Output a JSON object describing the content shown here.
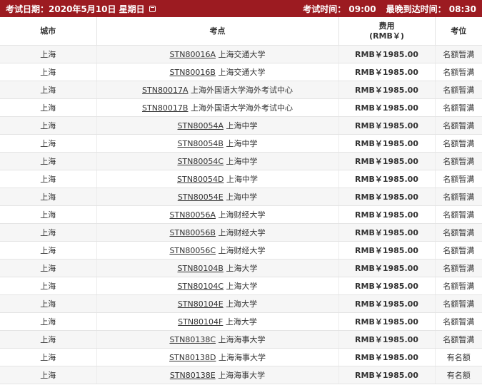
{
  "header": {
    "exam_date_label": "考试日期：",
    "exam_date_value": "2020年5月10日 星期日",
    "exam_time_label": "考试时间：",
    "exam_time_value": "09:00",
    "latest_arrival_label": "最晚到达时间：",
    "latest_arrival_value": "08:30",
    "icons": {
      "date": "calendar-icon"
    },
    "colors": {
      "bar": "#9c1b21"
    }
  },
  "table": {
    "columns": [
      "城市",
      "考点",
      "费用",
      "考位"
    ],
    "fee_unit": "(RMB￥)",
    "rows": [
      {
        "city": "上海",
        "code": "STN80016A",
        "venue": "上海交通大学",
        "fee": "RMB￥1985.00",
        "seat": "名额暂满"
      },
      {
        "city": "上海",
        "code": "STN80016B",
        "venue": "上海交通大学",
        "fee": "RMB￥1985.00",
        "seat": "名额暂满"
      },
      {
        "city": "上海",
        "code": "STN80017A",
        "venue": "上海外国语大学海外考试中心",
        "fee": "RMB￥1985.00",
        "seat": "名额暂满"
      },
      {
        "city": "上海",
        "code": "STN80017B",
        "venue": "上海外国语大学海外考试中心",
        "fee": "RMB￥1985.00",
        "seat": "名额暂满"
      },
      {
        "city": "上海",
        "code": "STN80054A",
        "venue": "上海中学",
        "fee": "RMB￥1985.00",
        "seat": "名额暂满"
      },
      {
        "city": "上海",
        "code": "STN80054B",
        "venue": "上海中学",
        "fee": "RMB￥1985.00",
        "seat": "名额暂满"
      },
      {
        "city": "上海",
        "code": "STN80054C",
        "venue": "上海中学",
        "fee": "RMB￥1985.00",
        "seat": "名额暂满"
      },
      {
        "city": "上海",
        "code": "STN80054D",
        "venue": "上海中学",
        "fee": "RMB￥1985.00",
        "seat": "名额暂满"
      },
      {
        "city": "上海",
        "code": "STN80054E",
        "venue": "上海中学",
        "fee": "RMB￥1985.00",
        "seat": "名额暂满"
      },
      {
        "city": "上海",
        "code": "STN80056A",
        "venue": "上海财经大学",
        "fee": "RMB￥1985.00",
        "seat": "名额暂满"
      },
      {
        "city": "上海",
        "code": "STN80056B",
        "venue": "上海财经大学",
        "fee": "RMB￥1985.00",
        "seat": "名额暂满"
      },
      {
        "city": "上海",
        "code": "STN80056C",
        "venue": "上海财经大学",
        "fee": "RMB￥1985.00",
        "seat": "名额暂满"
      },
      {
        "city": "上海",
        "code": "STN80104B",
        "venue": "上海大学",
        "fee": "RMB￥1985.00",
        "seat": "名额暂满"
      },
      {
        "city": "上海",
        "code": "STN80104C",
        "venue": "上海大学",
        "fee": "RMB￥1985.00",
        "seat": "名额暂满"
      },
      {
        "city": "上海",
        "code": "STN80104E",
        "venue": "上海大学",
        "fee": "RMB￥1985.00",
        "seat": "名额暂满"
      },
      {
        "city": "上海",
        "code": "STN80104F",
        "venue": "上海大学",
        "fee": "RMB￥1985.00",
        "seat": "名额暂满"
      },
      {
        "city": "上海",
        "code": "STN80138C",
        "venue": "上海海事大学",
        "fee": "RMB￥1985.00",
        "seat": "名额暂满"
      },
      {
        "city": "上海",
        "code": "STN80138D",
        "venue": "上海海事大学",
        "fee": "RMB￥1985.00",
        "seat": "有名额"
      },
      {
        "city": "上海",
        "code": "STN80138E",
        "venue": "上海海事大学",
        "fee": "RMB￥1985.00",
        "seat": "有名额"
      }
    ]
  }
}
